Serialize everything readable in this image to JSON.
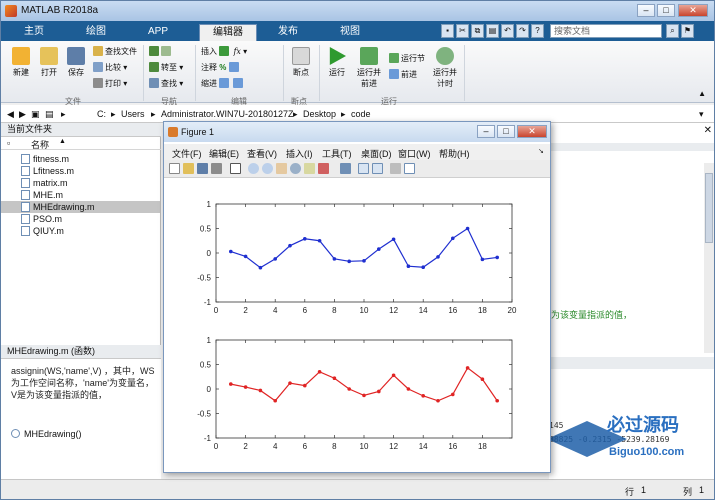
{
  "app": {
    "title": "MATLAB R2018a",
    "tabs": [
      "主页",
      "绘图",
      "APP",
      "编辑器",
      "发布",
      "视图"
    ],
    "active_tab": "编辑器",
    "search_placeholder": "搜索文档"
  },
  "ribbon": {
    "file_group": {
      "label": "文件",
      "new": "新建",
      "open": "打开",
      "save": "保存",
      "find_files": "查找文件",
      "compare": "比较",
      "print": "打印"
    },
    "nav_group": {
      "label": "导航",
      "goto": "转至",
      "find": "查找"
    },
    "edit_group": {
      "label": "编辑",
      "insert": "插入",
      "comment": "注释",
      "indent": "缩进",
      "fx": "fx"
    },
    "breakpoints_group": {
      "label": "断点",
      "breakpoints": "断点"
    },
    "run_group": {
      "label": "运行",
      "run": "运行",
      "run_and_advance": "运行并\n前进",
      "run_section": "运行节",
      "advance": "前进",
      "run_and_time": "运行并\n计时"
    }
  },
  "address": {
    "path": [
      "C:",
      "Users",
      "Administrator.WIN7U-20180127Z",
      "Desktop",
      "code"
    ]
  },
  "left_panel": {
    "title": "当前文件夹",
    "column_name": "名称",
    "files": [
      "fitness.m",
      "Lfitness.m",
      "matrix.m",
      "MHE.m",
      "MHEdrawing.m",
      "PSO.m",
      "QIUY.m"
    ],
    "selected_file": "MHEdrawing.m",
    "details_title": "MHEdrawing.m  (函数)",
    "details_text": "assignin(WS,'name',V) ，其中，WS为工作空间名称，'name'为变量名，V是为该变量指派的值，",
    "function_entry": "MHEdrawing()"
  },
  "right_panel": {
    "comment_text": "为该变量指派的值，",
    "workspace_lines": [
      "145",
      "88825   -0.2315  -5239.28169"
    ]
  },
  "figure": {
    "title": "Figure 1",
    "menus": [
      "文件(F)",
      "编辑(E)",
      "查看(V)",
      "插入(I)",
      "工具(T)",
      "桌面(D)",
      "窗口(W)",
      "帮助(H)"
    ],
    "blue_color": "#1f2fd0",
    "red_color": "#e02424"
  },
  "status": {
    "row_label": "行",
    "row_value": "1",
    "col_label": "列",
    "col_value": "1"
  },
  "watermark": {
    "brand": "必过源码",
    "url": "Biguo100.com"
  },
  "chart_data": [
    {
      "type": "line",
      "x": [
        1,
        2,
        3,
        4,
        5,
        6,
        7,
        8,
        9,
        10,
        11,
        12,
        13,
        14,
        15,
        16,
        17,
        18,
        19,
        20
      ],
      "values": [
        0.03,
        -0.07,
        -0.3,
        -0.12,
        0.15,
        0.29,
        0.25,
        -0.12,
        -0.17,
        -0.16,
        0.08,
        0.28,
        -0.27,
        -0.29,
        -0.08,
        0.3,
        0.5,
        -0.13,
        -0.09,
        null
      ],
      "xlim": [
        0,
        20
      ],
      "ylim": [
        -1,
        1
      ],
      "xticks": [
        0,
        2,
        4,
        6,
        8,
        10,
        12,
        14,
        16,
        18,
        20
      ],
      "yticks": [
        -1,
        -0.5,
        0,
        0.5,
        1
      ],
      "color": "#1f2fd0"
    },
    {
      "type": "line",
      "x": [
        1,
        2,
        3,
        4,
        5,
        6,
        7,
        8,
        9,
        10,
        11,
        12,
        13,
        14,
        15,
        16,
        17,
        18,
        19,
        20
      ],
      "values": [
        0.1,
        0.04,
        -0.03,
        -0.24,
        0.12,
        0.07,
        0.35,
        0.22,
        0.0,
        -0.13,
        -0.05,
        0.28,
        0.0,
        -0.14,
        -0.24,
        -0.11,
        0.43,
        0.2,
        -0.24,
        null
      ],
      "xlim": [
        0,
        20
      ],
      "ylim": [
        -1,
        1
      ],
      "xticks": [
        0,
        2,
        4,
        6,
        8,
        10,
        12,
        14,
        16,
        18
      ],
      "yticks": [
        -1,
        -0.5,
        0,
        0.5,
        1
      ],
      "color": "#e02424"
    }
  ]
}
